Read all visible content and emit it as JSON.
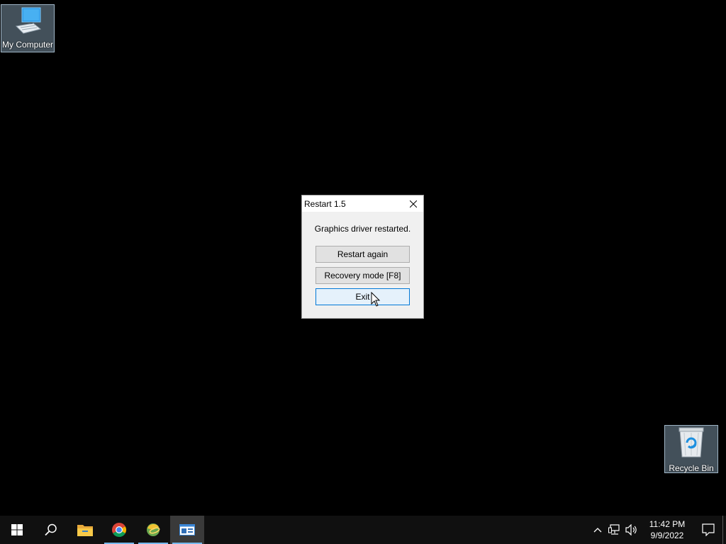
{
  "desktop": {
    "icons": [
      {
        "label": "My Computer",
        "icon": "computer-icon"
      },
      {
        "label": "Recycle Bin",
        "icon": "recycle-bin-icon"
      }
    ]
  },
  "dialog": {
    "title": "Restart 1.5",
    "message": "Graphics driver restarted.",
    "buttons": {
      "restart": "Restart again",
      "recovery": "Recovery mode [F8]",
      "exit": "Exit"
    }
  },
  "taskbar": {
    "pinned": [
      "start-icon",
      "search-icon",
      "file-explorer-icon",
      "chrome-icon",
      "app-icon",
      "restart-app-icon"
    ],
    "clock": {
      "time": "11:42 PM",
      "date": "9/9/2022"
    },
    "tray_icons": [
      "chevron-up-icon",
      "network-icon",
      "volume-icon",
      "notification-icon"
    ]
  },
  "colors": {
    "accent": "#0078d7",
    "taskbar": "#101010",
    "desktop": "#000000",
    "running_indicator": "#76b9ed"
  }
}
